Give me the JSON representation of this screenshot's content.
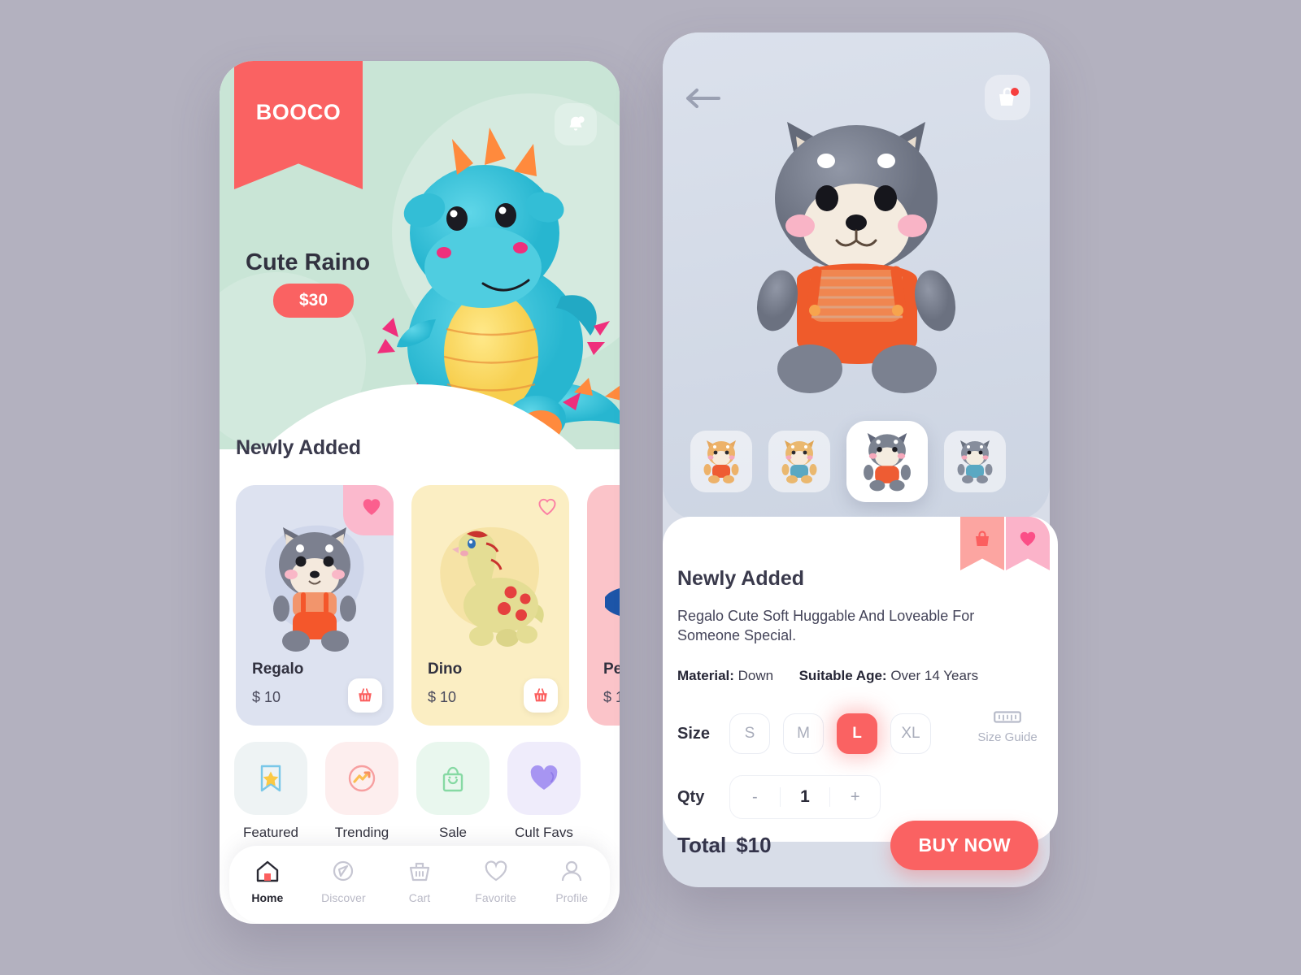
{
  "app": {
    "brand": "BOOCO",
    "bg_color": "#b3b1bf",
    "accent_color": "#fa6262",
    "mint_color": "#c9e5d6"
  },
  "home": {
    "notification_icon": "bell-icon",
    "hero": {
      "title": "Cute Raino",
      "price": "$30",
      "image_alt": "blue dragon plush"
    },
    "section_title": "Newly Added",
    "products": [
      {
        "name": "Regalo",
        "price": "$ 10",
        "bg": "#dde2f0",
        "favorited": true,
        "cart_icon": "basket-icon"
      },
      {
        "name": "Dino",
        "price": "$ 10",
        "bg": "#fbeec3",
        "favorited": false,
        "cart_icon": "basket-icon"
      },
      {
        "name": "Pe",
        "price": "$ 1",
        "bg": "#fbc4c9",
        "favorited": false,
        "cart_icon": "basket-icon"
      }
    ],
    "categories": [
      {
        "label": "Featured",
        "icon": "bookmark-star-icon",
        "bg": "#eef3f4",
        "color": "#7ec8e8"
      },
      {
        "label": "Trending",
        "icon": "trending-up-icon",
        "bg": "#fdeeee",
        "color": "#f79fa0"
      },
      {
        "label": "Sale",
        "icon": "shopping-bag-icon",
        "bg": "#e9f7ee",
        "color": "#8adba5"
      },
      {
        "label": "Cult Favs",
        "icon": "heart-icon",
        "bg": "#efecfb",
        "color": "#9d8cf0"
      }
    ],
    "nav": [
      {
        "label": "Home",
        "icon": "home-icon",
        "active": true
      },
      {
        "label": "Discover",
        "icon": "compass-icon",
        "active": false
      },
      {
        "label": "Cart",
        "icon": "basket-icon",
        "active": false
      },
      {
        "label": "Favorite",
        "icon": "heart-icon",
        "active": false
      },
      {
        "label": "Profile",
        "icon": "person-icon",
        "active": false
      }
    ]
  },
  "detail": {
    "back_icon": "arrow-left-icon",
    "cart_icon": "bag-icon",
    "cart_badge": true,
    "thumbnails": [
      {
        "alt": "orange shiba plush",
        "selected": false
      },
      {
        "alt": "tan shiba plush",
        "selected": false
      },
      {
        "alt": "grey shiba plush",
        "selected": true
      },
      {
        "alt": "grey blue shiba",
        "selected": false
      }
    ],
    "badges": [
      {
        "icon": "bag-icon",
        "color": "#fca5a1"
      },
      {
        "icon": "heart-icon",
        "color": "#fbb3c9"
      }
    ],
    "title": "Newly Added",
    "description": "Regalo Cute Soft Huggable And Loveable For Someone Special.",
    "meta": [
      {
        "label": "Material:",
        "value": "Down"
      },
      {
        "label": "Suitable Age:",
        "value": "Over 14 Years"
      }
    ],
    "size_label": "Size",
    "sizes": [
      {
        "label": "S",
        "selected": false
      },
      {
        "label": "M",
        "selected": false
      },
      {
        "label": "L",
        "selected": true
      },
      {
        "label": "XL",
        "selected": false
      }
    ],
    "size_guide": {
      "label": "Size Guide",
      "icon": "ruler-icon"
    },
    "qty_label": "Qty",
    "qty": {
      "minus": "-",
      "value": "1",
      "plus": "+"
    },
    "total_label": "Total",
    "total_amount": "$10",
    "buy_label": "BUY NOW"
  }
}
